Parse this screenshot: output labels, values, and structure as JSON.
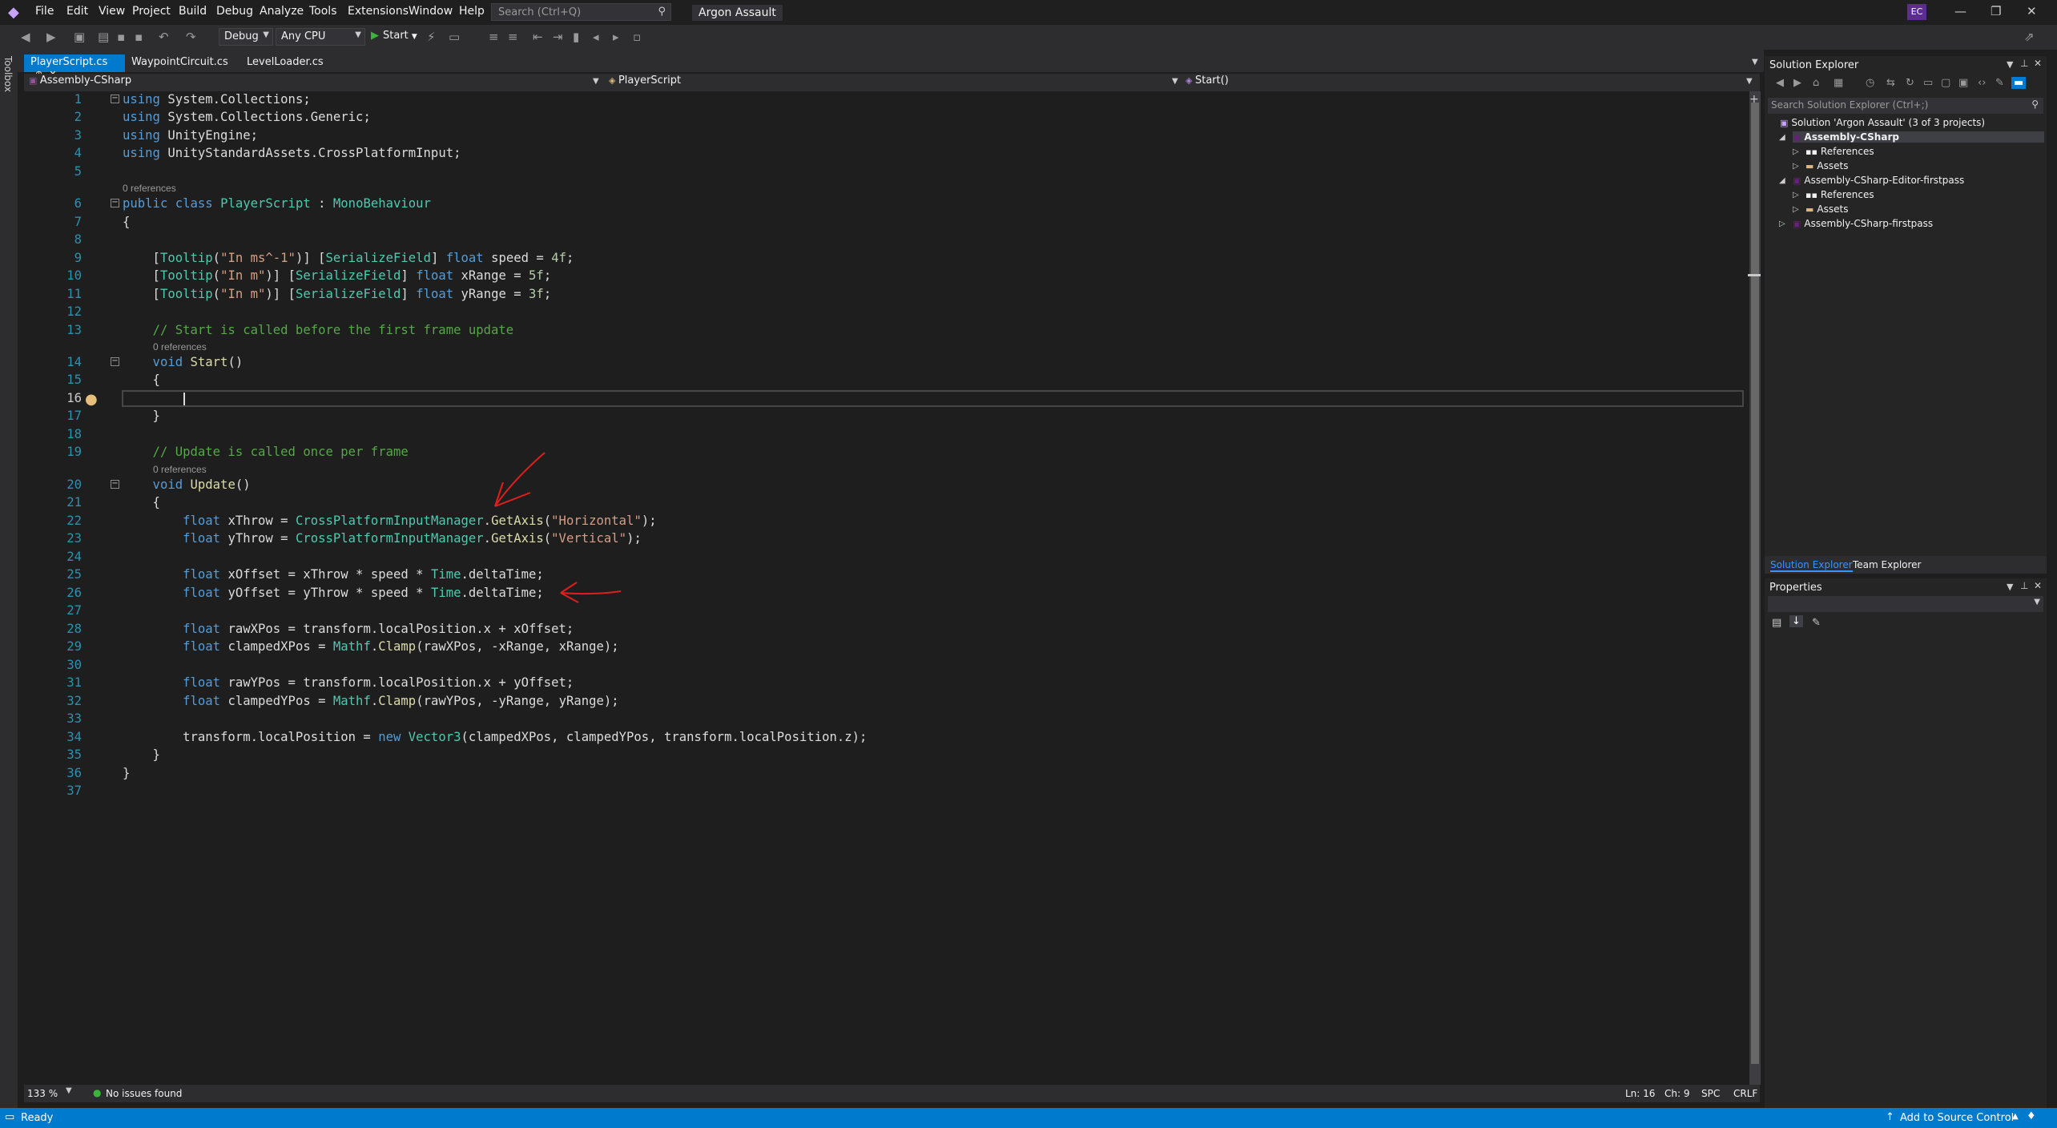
{
  "menu": [
    "File",
    "Edit",
    "View",
    "Project",
    "Build",
    "Debug",
    "Analyze",
    "Tools",
    "Extensions",
    "Window",
    "Help"
  ],
  "search": {
    "placeholder": "Search (Ctrl+Q)"
  },
  "solution_name": "Argon Assault",
  "user_initials": "EC",
  "toolbar": {
    "config": "Debug",
    "platform": "Any CPU",
    "start_label": "Start"
  },
  "toolbox_label": "Toolbox",
  "tabs": [
    "PlayerScript.cs",
    "WaypointCircuit.cs",
    "LevelLoader.cs"
  ],
  "nav": {
    "project": "Assembly-CSharp",
    "class": "PlayerScript",
    "member": "Start()"
  },
  "codelens": "0 references",
  "editor_status": {
    "zoom": "133 %",
    "issues": "No issues found",
    "position": "Ln: 16",
    "char": "Ch: 9",
    "spaces": "SPC",
    "eol": "CRLF"
  },
  "solution_explorer": {
    "title": "Solution Explorer",
    "search_placeholder": "Search Solution Explorer (Ctrl+;)",
    "solution": "Solution 'Argon Assault' (3 of 3 projects)",
    "items": [
      {
        "label": "Assembly-CSharp"
      },
      {
        "label": "References"
      },
      {
        "label": "Assets"
      },
      {
        "label": "Assembly-CSharp-Editor-firstpass"
      },
      {
        "label": "References"
      },
      {
        "label": "Assets"
      },
      {
        "label": "Assembly-CSharp-firstpass"
      }
    ],
    "tabs": [
      "Solution Explorer",
      "Team Explorer"
    ]
  },
  "properties": {
    "title": "Properties"
  },
  "status": {
    "ready": "Ready",
    "source_control": "Add to Source Control"
  },
  "colors": {
    "accent": "#007acc",
    "background": "#1e1e1e",
    "annotation": "#e01e1e"
  }
}
